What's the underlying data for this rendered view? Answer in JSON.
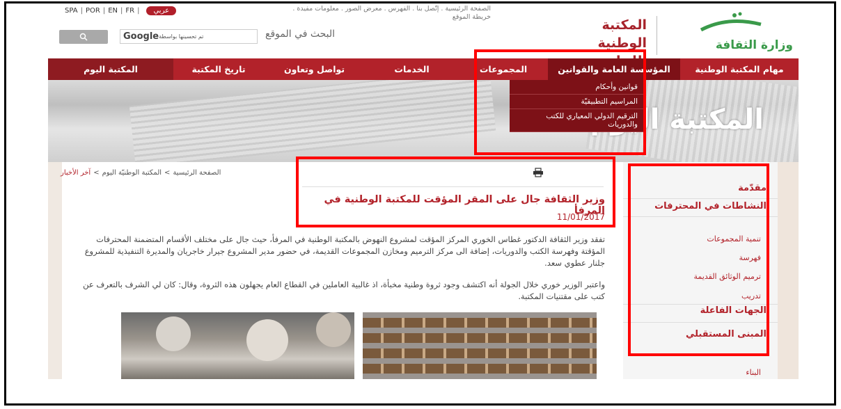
{
  "top_bar": {
    "languages": [
      "SPA",
      "POR",
      "EN",
      "FR"
    ],
    "arabic_button": "عربي",
    "util_links_line1": "الصفحة الرئيسية  .  إتّصل بنا  .  الفهرس  .  معرض الصور  .  معلومات مفيدة  .",
    "util_links_line2": "خريطة الموقع"
  },
  "search": {
    "label": "البحث في الموقع",
    "placeholder_prefix": "تم تحسينها بواسطة",
    "placeholder_brand": "Google"
  },
  "branding": {
    "library_name_line1": "المكتبة الوطنية",
    "library_name_line2": "اللبنانية",
    "ministry_name": "وزارة الثقافة"
  },
  "nav": {
    "items": [
      "مهام المكتبة الوطنية",
      "المؤسسة العامة والقوانين",
      "المجموعات",
      "الخدمات",
      "تواصل وتعاون",
      "تاريخ المكتبة",
      "المكتبة اليوم"
    ]
  },
  "dropdown": {
    "items": [
      "قوانين وأحكام",
      "المراسيم التطبيقيّة",
      "الترقيم الدولي المعياري للكتب والدوريات"
    ]
  },
  "banner": {
    "title": "المكتبة اليوم"
  },
  "breadcrumb": {
    "home": "الصفحة الرئيسية",
    "parent": "المكتبة الوطنيّة اليوم",
    "current": "آخر الأخبار"
  },
  "article": {
    "headline": "وزير الثقافة جال على المقر المؤقت للمكتبة الوطنية في المرفأ",
    "date": "11/01/2017",
    "paragraph1": "تفقد وزير الثقافة الدكتور غطاس الخوري المركز المؤقت لمشروع النهوض بالمكتبة الوطنية في المرفأ، حيث جال على مختلف الأقسام المتضمنة المحترفات المؤقتة وفهرسة الكتب والدوريات، إضافة الى مركز الترميم ومخازن المجموعات القديمة، في حضور مدير المشروع جيرار خاجريان والمديرة التنفيذية للمشروع جلنار عطوي سعد.",
    "paragraph2": "واعتبر الوزير خوري خلال الجولة أنه اكتشف وجود ثروة وطنية مخبأة، اذ غالبية العاملين في القطاع العام يجهلون هذه الثروة، وقال: كان لي الشرف بالتعرف عن كتب على مقتنيات المكتبة."
  },
  "sidebar": {
    "intro": "مقدّمة",
    "workshops": "النشاطات في المحترفات",
    "sub_items": [
      "تنمية المجموعات",
      "فهرسة",
      "ترميم الوثائق القديمة",
      "تدريب"
    ],
    "actors": "الجهات الفاعلة",
    "future_building": "المبنى المستقبلي",
    "sub_items_2": [
      "البناء"
    ]
  },
  "colors": {
    "brand_red": "#b2222a",
    "nav_active": "#7d1117",
    "ministry_green": "#3a9a4a",
    "highlight": "#ff0000"
  }
}
